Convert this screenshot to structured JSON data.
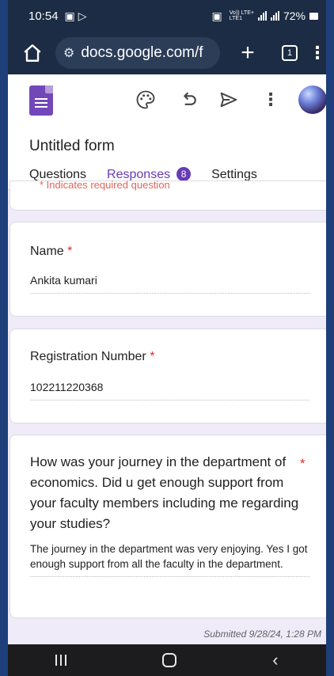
{
  "status": {
    "time": "10:54",
    "network_top": "Vo))",
    "network_label": "LTE+",
    "network_sub": "LTE1",
    "battery": "72%"
  },
  "browser": {
    "url": "docs.google.com/f",
    "tab_count": "1",
    "icons": [
      "home-icon",
      "tune-icon",
      "plus-icon",
      "tabs-icon",
      "more-vert-icon"
    ]
  },
  "app": {
    "title": "Untitled form",
    "toolbar_icons": [
      "palette-icon",
      "undo-icon",
      "send-icon",
      "more-vert-icon"
    ],
    "tabs": [
      {
        "label": "Questions"
      },
      {
        "label": "Responses",
        "badge": "8"
      },
      {
        "label": "Settings"
      }
    ],
    "accent": "#673ab7"
  },
  "form": {
    "required_note": "* Indicates required question",
    "questions": [
      {
        "title": "Name",
        "required": "*",
        "answer": "Ankita kumari"
      },
      {
        "title": "Registration Number",
        "required": "*",
        "answer": "102211220368"
      },
      {
        "title": "How was your journey in the department of economics. Did u get enough support from your faculty members including me regarding your studies?",
        "required": "*",
        "answer": "The journey in the department was very enjoying. Yes I got enough support from all the faculty in the department."
      }
    ],
    "submitted": "Submitted 9/28/24, 1:28 PM"
  }
}
